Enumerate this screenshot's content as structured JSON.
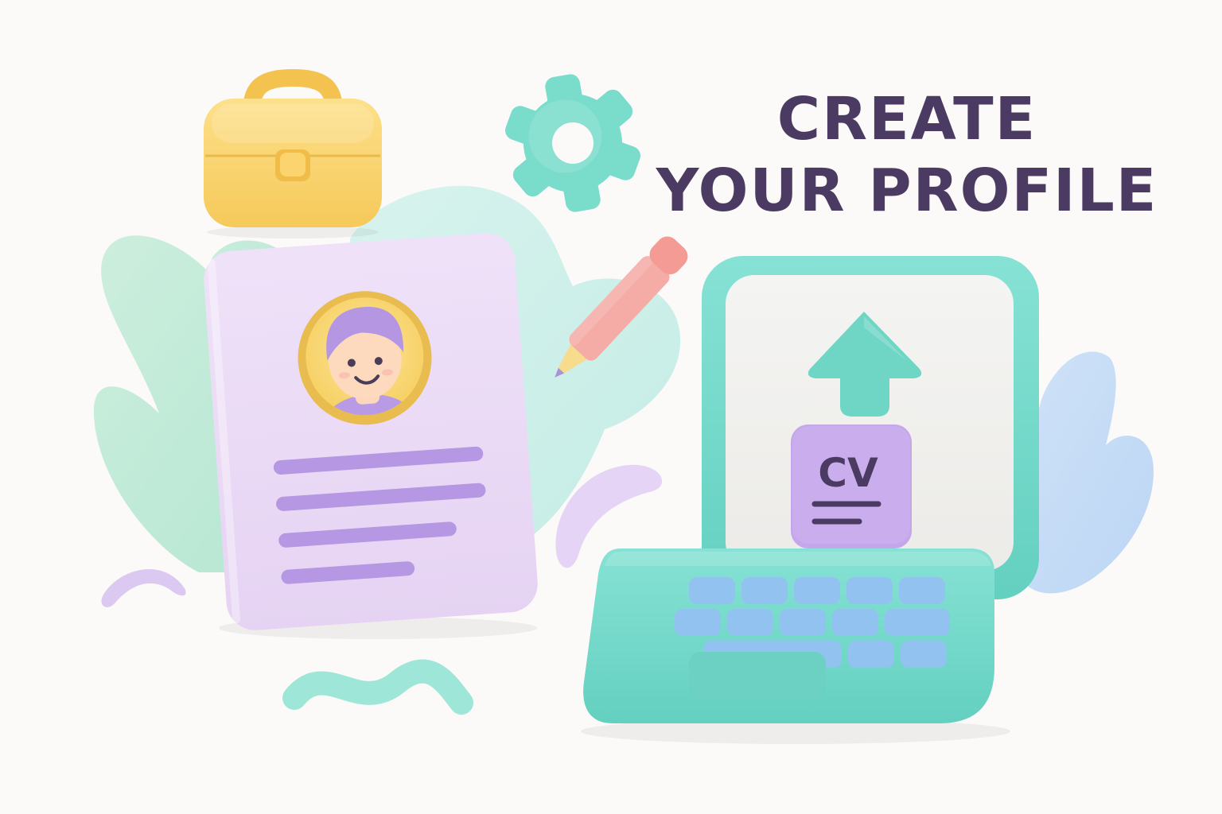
{
  "headline": {
    "line1": "CREATE",
    "line2": "YOUR PROFILE"
  },
  "laptop": {
    "document_label": "CV"
  },
  "icons": [
    "briefcase-icon",
    "gear-icon",
    "pencil-icon",
    "profile-card-icon",
    "avatar-icon",
    "laptop-icon",
    "upload-arrow-icon",
    "cv-document-icon"
  ],
  "colors": {
    "headline": "#4b3b63",
    "background": "#fcfaf8",
    "lavender": "#efe0f7",
    "purple": "#b396e3",
    "mint": "#76dccc",
    "mint_dark": "#62cdbd",
    "yellow": "#fcd872",
    "pink": "#f4a5a0",
    "blue_key": "#92c2f0"
  }
}
